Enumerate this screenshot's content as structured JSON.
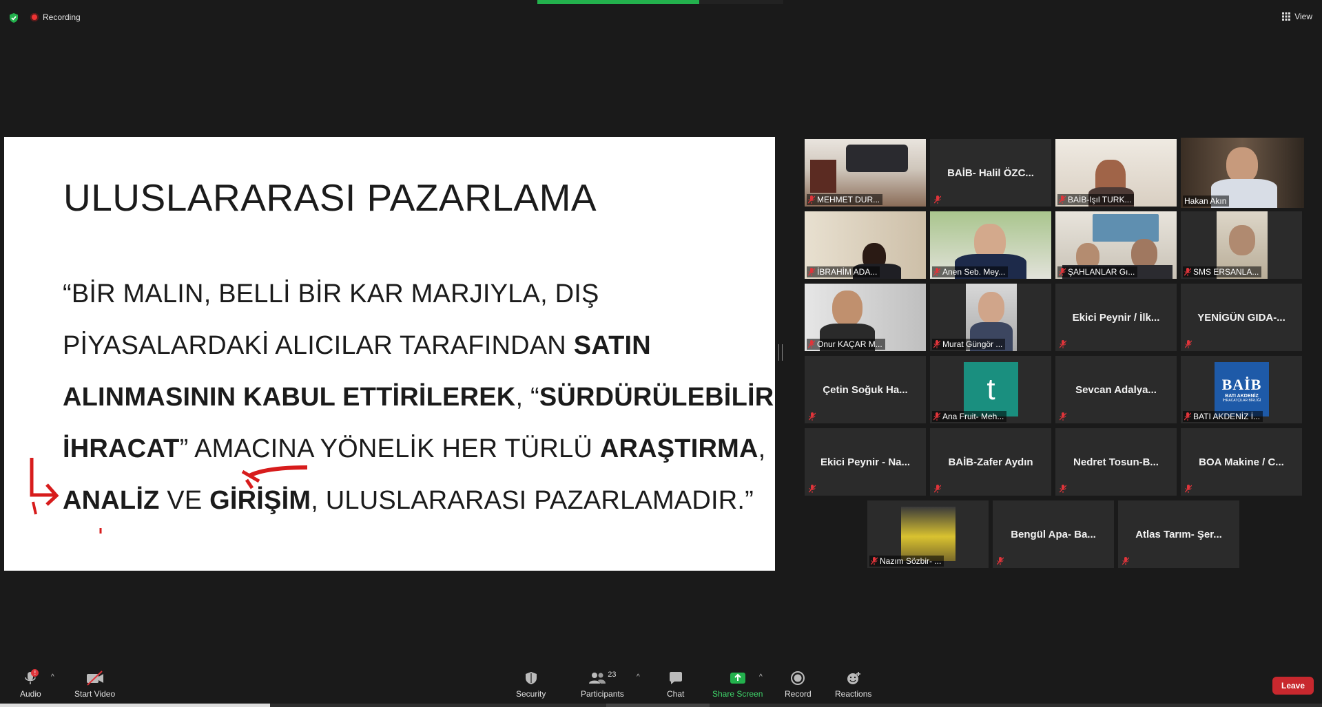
{
  "header": {
    "recording_label": "Recording",
    "view_label": "View"
  },
  "slide": {
    "title": "ULUSLARARASI PAZARLAMA",
    "line1": "“BİR MALIN, BELLİ BİR KAR MARJIYLA,  DIŞ",
    "line2_a": "PİYASALARDAKİ ALICILAR TARAFINDAN ",
    "line2_b": "SATIN",
    "line3_a": "ALINMASININ KABUL ETTİRİLEREK",
    "line3_b": ",  “",
    "line3_c": "SÜRDÜRÜLEBİLİR",
    "line4_a": "İHRACAT",
    "line4_b": "” AMACINA YÖNELİK HER TÜRLÜ ",
    "line4_c": "ARAŞTIRMA",
    "line4_d": ",",
    "line5_a": "ANALİZ",
    "line5_b": " VE ",
    "line5_c": "GİRİŞİM",
    "line5_d": ", ULUSLARARASI PAZARLAMADIR.”"
  },
  "participants": {
    "tiles": [
      {
        "label": "MEHMET DUR..."
      },
      {
        "name": "BAİB-  Halil  ÖZC..."
      },
      {
        "label": "BAİB-Işıl TURK..."
      },
      {
        "label": "Hakan Akın"
      },
      {
        "label": "İBRAHİM ADA..."
      },
      {
        "label": "Anen Seb. Mey..."
      },
      {
        "label": "ŞAHLANLAR Gı..."
      },
      {
        "label": "SMS ERSANLA..."
      },
      {
        "label": "Onur KAÇAR M..."
      },
      {
        "label": "Murat Güngör ..."
      },
      {
        "name": "Ekici  Peynir / İlk..."
      },
      {
        "name": "YENİGÜN  GIDA-..."
      },
      {
        "name": "Çetin  Soğuk  Ha..."
      },
      {
        "label": "Ana Fruit- Meh...",
        "avatar_letter": "t"
      },
      {
        "name": "Sevcan  Adalya..."
      },
      {
        "label": "BATI AKDENİZ İ...",
        "logo_text": "BAİB",
        "logo_sub": "BATI AKDENİZ",
        "logo_sub2": "İHRACATÇILAR BİRLİĞİ"
      },
      {
        "name": "Ekici  Peynir  -  Na..."
      },
      {
        "name": "BAİB-Zafer  Aydın"
      },
      {
        "name": "Nedret  Tosun-B..."
      },
      {
        "name": "BOA  Makine  /  C..."
      },
      {
        "label": "Nazım Sözbir- ..."
      },
      {
        "name": "Bengül  Apa-  Ba..."
      },
      {
        "name": "Atlas  Tarım-  Şer..."
      }
    ]
  },
  "toolbar": {
    "audio": "Audio",
    "audio_badge": "!",
    "start_video": "Start Video",
    "security": "Security",
    "participants": "Participants",
    "participants_count": "23",
    "chat": "Chat",
    "share_screen": "Share Screen",
    "record": "Record",
    "reactions": "Reactions",
    "leave": "Leave"
  },
  "colors": {
    "background": "#1a1a1a",
    "tile": "#2b2b2b",
    "active_speaker": "#e6f38a",
    "leave": "#c8282e",
    "share_green": "#23b14d",
    "muted_red": "#e0343a"
  }
}
